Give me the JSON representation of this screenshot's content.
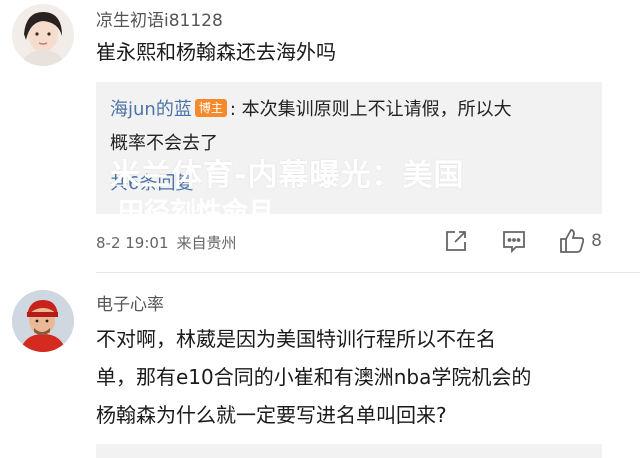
{
  "comments": [
    {
      "username": "凉生初语i81128",
      "text": "崔永熙和杨翰森还去海外吗",
      "reply": {
        "author": "海jun的蓝",
        "badge": "博主",
        "text_line1": ": 本次集训原则上不让请假，所以大",
        "text_line2": "概率不会去了",
        "more": "共6条回复"
      },
      "time": "8-2 19:01",
      "location": "来自贵州",
      "likes": "8"
    },
    {
      "username": "电子心率",
      "text_lines": [
        "不对啊，林葳是因为美国特训行程所以不在名",
        "单，那有e10合同的小崔和有澳洲nba学院机会的",
        "杨翰森为什么就一定要写进名单叫回来?"
      ]
    }
  ],
  "overlay": {
    "line1": "米兰体育-内幕曝光：美国",
    "line2": "田径刻性命月"
  },
  "colors": {
    "link": "#4b73a8",
    "badge": "#f48a2a",
    "reply_bg": "#f2f2f2"
  },
  "icons": [
    "share-icon",
    "comment-icon",
    "like-icon"
  ]
}
